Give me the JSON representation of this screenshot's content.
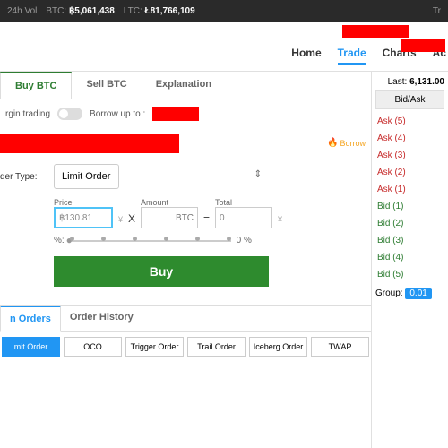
{
  "topbar": {
    "vol_label": "24h Vol",
    "btc_label": "BTC:",
    "btc_value": "฿5,061,438",
    "ltc_label": "LTC:",
    "ltc_value": "Ł81,766,109",
    "right": "Tr"
  },
  "nav": {
    "home": "Home",
    "trade": "Trade",
    "charts": "Charts",
    "account": "Ac"
  },
  "trade_tabs": {
    "buy": "Buy BTC",
    "sell": "Sell BTC",
    "explain": "Explanation"
  },
  "margin": {
    "label": "rgin trading",
    "borrow_label": "Borrow up to :"
  },
  "borrow_badge": "Borrow",
  "form": {
    "order_type_label": "der Type:",
    "order_type_value": "Limit Order",
    "price_label": "Price",
    "price_value": "฿130.81",
    "price_unit": "¥",
    "amount_label": "Amount",
    "amount_unit": "BTC",
    "total_label": "Total",
    "total_value": "0",
    "total_unit": "¥",
    "percent_label": "%:",
    "percent_value": "0 %",
    "buy_label": "Buy"
  },
  "book": {
    "last_label": "Last:",
    "last_value": "6,131.00",
    "header": "Bid/Ask",
    "asks": [
      "Ask (5)",
      "Ask (4)",
      "Ask (3)",
      "Ask (2)",
      "Ask (1)"
    ],
    "bids": [
      "Bid (1)",
      "Bid (2)",
      "Bid (3)",
      "Bid (4)",
      "Bid (5)"
    ],
    "group_label": "Group:",
    "group_value": "0.01"
  },
  "orders": {
    "open_tab": "n Orders",
    "history_tab": "Order History",
    "filters": [
      "mit Order",
      "OCO",
      "Trigger Order",
      "Trail Order",
      "Iceberg Order",
      "TWAP"
    ]
  }
}
